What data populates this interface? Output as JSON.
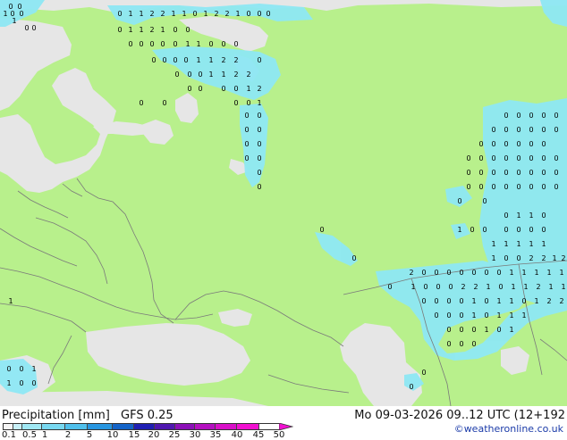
{
  "title": {
    "product": "Precipitation [mm]",
    "model": "GFS 0.25",
    "datetime": "Mo 09-03-2026 09..12 UTC (12+192",
    "credit": "©weatheronline.co.uk"
  },
  "legend": {
    "ticks": [
      "0.1",
      "0.5",
      "1",
      "2",
      "5",
      "10",
      "15",
      "20",
      "25",
      "30",
      "35",
      "40",
      "45",
      "50"
    ],
    "colors": [
      "#f5f5f5",
      "#c8f0f8",
      "#a0e8f4",
      "#78d8f0",
      "#50c0ec",
      "#2896e0",
      "#1464c8",
      "#2020b4",
      "#5018b0",
      "#8c10b8",
      "#b410c0",
      "#d810c8",
      "#f010d0"
    ]
  },
  "map": {
    "land_color": "#b8f08c",
    "sea_color": "#e6e6e6",
    "border_color": "#7a7a7a",
    "precip_color": "#8ee8f4",
    "labels": [
      {
        "t": "0"
      },
      {
        "t": "0"
      },
      {
        "t": "1"
      },
      {
        "t": "0"
      },
      {
        "t": "0"
      },
      {
        "t": "1"
      },
      {
        "t": "0"
      },
      {
        "t": "0"
      },
      {
        "t": "0"
      },
      {
        "t": "1"
      },
      {
        "t": "1"
      },
      {
        "t": "2"
      },
      {
        "t": "2"
      },
      {
        "t": "1"
      },
      {
        "t": "1"
      },
      {
        "t": "0"
      },
      {
        "t": "1"
      },
      {
        "t": "2"
      },
      {
        "t": "2"
      },
      {
        "t": "1"
      },
      {
        "t": "0"
      },
      {
        "t": "0"
      },
      {
        "t": "0"
      },
      {
        "t": "0"
      },
      {
        "t": "1"
      },
      {
        "t": "1"
      },
      {
        "t": "2"
      },
      {
        "t": "1"
      },
      {
        "t": "0"
      },
      {
        "t": "0"
      },
      {
        "t": "0"
      },
      {
        "t": "0"
      },
      {
        "t": "0"
      },
      {
        "t": "0"
      },
      {
        "t": "0"
      },
      {
        "t": "1"
      },
      {
        "t": "1"
      },
      {
        "t": "0"
      },
      {
        "t": "0"
      },
      {
        "t": "0"
      },
      {
        "t": "0"
      },
      {
        "t": "0"
      },
      {
        "t": "0"
      },
      {
        "t": "0"
      },
      {
        "t": "1"
      },
      {
        "t": "1"
      },
      {
        "t": "2"
      },
      {
        "t": "2"
      },
      {
        "t": "0"
      },
      {
        "t": "0"
      },
      {
        "t": "0"
      },
      {
        "t": "0"
      },
      {
        "t": "1"
      },
      {
        "t": "1"
      },
      {
        "t": "2"
      },
      {
        "t": "2"
      },
      {
        "t": "0"
      },
      {
        "t": "0"
      },
      {
        "t": "0"
      },
      {
        "t": "0"
      },
      {
        "t": "1"
      },
      {
        "t": "2"
      },
      {
        "t": "0"
      },
      {
        "t": "0"
      },
      {
        "t": "0"
      },
      {
        "t": "0"
      },
      {
        "t": "1"
      },
      {
        "t": "0"
      },
      {
        "t": "0"
      },
      {
        "t": "0"
      },
      {
        "t": "0"
      },
      {
        "t": "0"
      },
      {
        "t": "0"
      },
      {
        "t": "0"
      },
      {
        "t": "0"
      },
      {
        "t": "0"
      },
      {
        "t": "0"
      },
      {
        "t": "0"
      },
      {
        "t": "0"
      },
      {
        "t": "0"
      },
      {
        "t": "0"
      },
      {
        "t": "0"
      },
      {
        "t": "0"
      },
      {
        "t": "0"
      },
      {
        "t": "0"
      },
      {
        "t": "0"
      },
      {
        "t": "0"
      },
      {
        "t": "0"
      },
      {
        "t": "0"
      },
      {
        "t": "0"
      },
      {
        "t": "0"
      },
      {
        "t": "0"
      },
      {
        "t": "0"
      },
      {
        "t": "0"
      },
      {
        "t": "0"
      },
      {
        "t": "0"
      },
      {
        "t": "0"
      },
      {
        "t": "0"
      },
      {
        "t": "0"
      },
      {
        "t": "0"
      },
      {
        "t": "0"
      },
      {
        "t": "0"
      },
      {
        "t": "0"
      },
      {
        "t": "0"
      },
      {
        "t": "0"
      },
      {
        "t": "0"
      },
      {
        "t": "0"
      },
      {
        "t": "0"
      },
      {
        "t": "0"
      },
      {
        "t": "0"
      },
      {
        "t": "0"
      },
      {
        "t": "0"
      },
      {
        "t": "0"
      },
      {
        "t": "0"
      },
      {
        "t": "0"
      },
      {
        "t": "0"
      },
      {
        "t": "0"
      },
      {
        "t": "0"
      },
      {
        "t": "0"
      },
      {
        "t": "0"
      },
      {
        "t": "0"
      },
      {
        "t": "0"
      },
      {
        "t": "0"
      },
      {
        "t": "1"
      },
      {
        "t": "1"
      },
      {
        "t": "0"
      },
      {
        "t": "1"
      },
      {
        "t": "0"
      },
      {
        "t": "0"
      },
      {
        "t": "0"
      },
      {
        "t": "0"
      },
      {
        "t": "0"
      },
      {
        "t": "0"
      },
      {
        "t": "1"
      },
      {
        "t": "1"
      },
      {
        "t": "1"
      },
      {
        "t": "1"
      },
      {
        "t": "1"
      },
      {
        "t": "1"
      },
      {
        "t": "0"
      },
      {
        "t": "0"
      },
      {
        "t": "2"
      },
      {
        "t": "2"
      },
      {
        "t": "1"
      },
      {
        "t": "2"
      },
      {
        "t": "2"
      },
      {
        "t": "0"
      },
      {
        "t": "0"
      },
      {
        "t": "0"
      },
      {
        "t": "0"
      },
      {
        "t": "0"
      },
      {
        "t": "0"
      },
      {
        "t": "0"
      },
      {
        "t": "1"
      },
      {
        "t": "1"
      },
      {
        "t": "1"
      },
      {
        "t": "1"
      },
      {
        "t": "1"
      },
      {
        "t": "0"
      },
      {
        "t": "1"
      },
      {
        "t": "0"
      },
      {
        "t": "0"
      },
      {
        "t": "0"
      },
      {
        "t": "2"
      },
      {
        "t": "2"
      },
      {
        "t": "1"
      },
      {
        "t": "0"
      },
      {
        "t": "1"
      },
      {
        "t": "1"
      },
      {
        "t": "2"
      },
      {
        "t": "1"
      },
      {
        "t": "1"
      },
      {
        "t": "0"
      },
      {
        "t": "0"
      },
      {
        "t": "0"
      },
      {
        "t": "0"
      },
      {
        "t": "1"
      },
      {
        "t": "0"
      },
      {
        "t": "1"
      },
      {
        "t": "1"
      },
      {
        "t": "0"
      },
      {
        "t": "1"
      },
      {
        "t": "2"
      },
      {
        "t": "2"
      },
      {
        "t": "1"
      },
      {
        "t": "0"
      },
      {
        "t": "0"
      },
      {
        "t": "0"
      },
      {
        "t": "1"
      },
      {
        "t": "0"
      },
      {
        "t": "1"
      },
      {
        "t": "1"
      },
      {
        "t": "1"
      },
      {
        "t": "0"
      },
      {
        "t": "0"
      },
      {
        "t": "0"
      },
      {
        "t": "1"
      },
      {
        "t": "0"
      },
      {
        "t": "1"
      },
      {
        "t": "0"
      },
      {
        "t": "0"
      },
      {
        "t": "0"
      },
      {
        "t": "0"
      },
      {
        "t": "0"
      },
      {
        "t": "1"
      },
      {
        "t": "1"
      },
      {
        "t": "0"
      },
      {
        "t": "0"
      },
      {
        "t": "0"
      },
      {
        "t": "0"
      },
      {
        "t": "0"
      }
    ]
  }
}
